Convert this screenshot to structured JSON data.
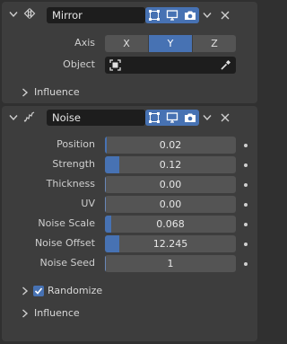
{
  "mirror": {
    "name": "Mirror",
    "axis_label": "Axis",
    "axes": [
      {
        "label": "X",
        "active": false
      },
      {
        "label": "Y",
        "active": true
      },
      {
        "label": "Z",
        "active": false
      }
    ],
    "object_label": "Object",
    "influence_label": "Influence"
  },
  "noise": {
    "name": "Noise",
    "fields": [
      {
        "label": "Position",
        "value": "0.02",
        "fill": 0.01
      },
      {
        "label": "Strength",
        "value": "0.12",
        "fill": 0.11
      },
      {
        "label": "Thickness",
        "value": "0.00",
        "fill": 0
      },
      {
        "label": "UV",
        "value": "0.00",
        "fill": 0
      },
      {
        "label": "Noise Scale",
        "value": "0.068",
        "fill": 0.05
      },
      {
        "label": "Noise Offset",
        "value": "12.245",
        "fill": 0.11
      },
      {
        "label": "Noise Seed",
        "value": "1",
        "fill": 0
      }
    ],
    "randomize_label": "Randomize",
    "randomize_checked": true,
    "influence_label": "Influence"
  },
  "colors": {
    "accent": "#4772b3",
    "panel": "#3d3d3d",
    "field": "#545454",
    "background": "#303030"
  }
}
